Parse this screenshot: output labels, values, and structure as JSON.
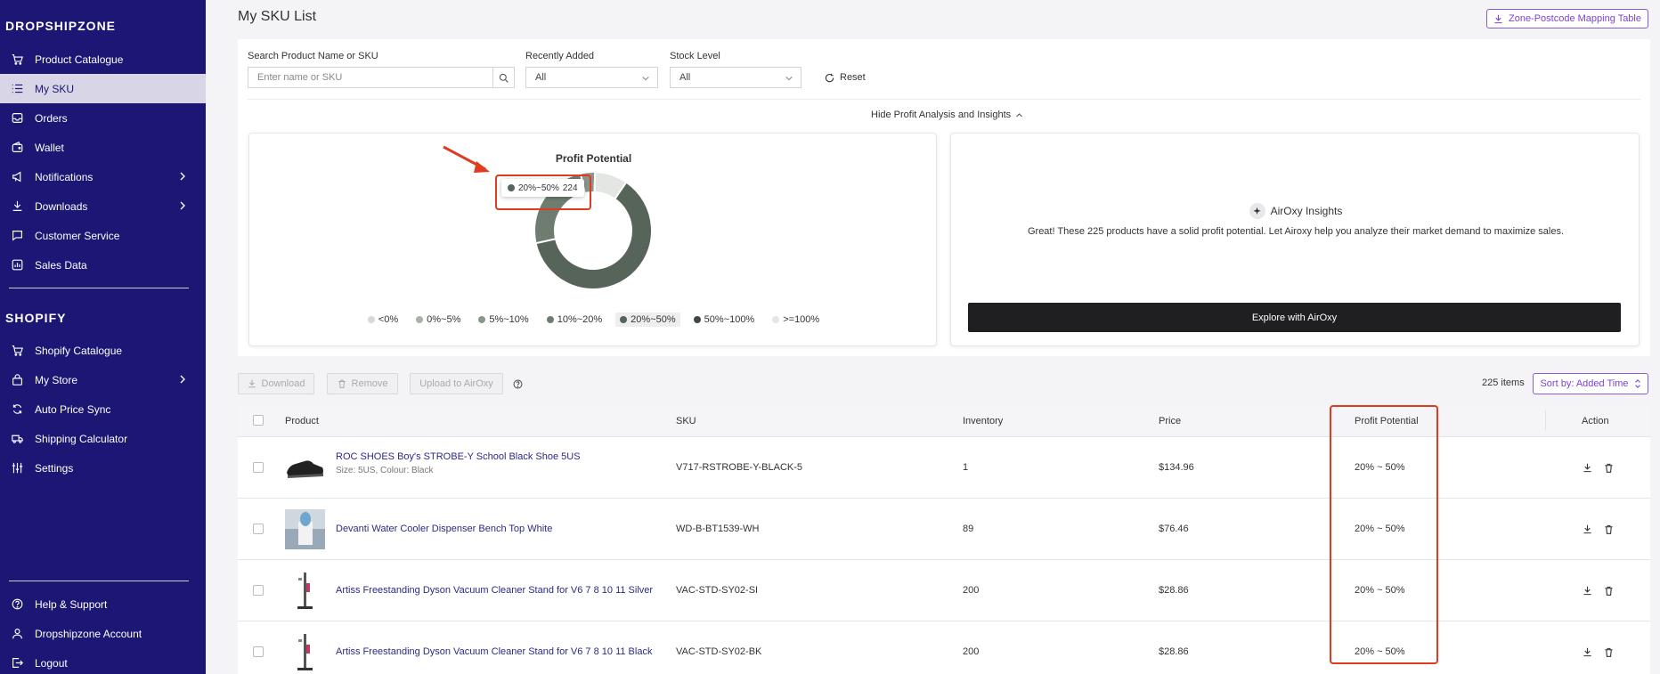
{
  "sidebar": {
    "brand": "DROPSHIPZONE",
    "items": [
      {
        "label": "Product Catalogue"
      },
      {
        "label": "My SKU"
      },
      {
        "label": "Orders"
      },
      {
        "label": "Wallet"
      },
      {
        "label": "Notifications"
      },
      {
        "label": "Downloads"
      },
      {
        "label": "Customer Service"
      },
      {
        "label": "Sales Data"
      }
    ],
    "shopify_heading": "SHOPIFY",
    "shopify_items": [
      {
        "label": "Shopify Catalogue"
      },
      {
        "label": "My Store"
      },
      {
        "label": "Auto Price Sync"
      },
      {
        "label": "Shipping Calculator"
      },
      {
        "label": "Settings"
      }
    ],
    "footer_items": [
      {
        "label": "Help & Support"
      },
      {
        "label": "Dropshipzone Account"
      },
      {
        "label": "Logout"
      }
    ]
  },
  "header": {
    "title": "My SKU List",
    "mapping_button": "Zone-Postcode Mapping Table"
  },
  "filters": {
    "search_label": "Search Product Name or SKU",
    "search_placeholder": "Enter name or SKU",
    "recent_label": "Recently Added",
    "recent_value": "All",
    "stock_label": "Stock Level",
    "stock_value": "All",
    "reset": "Reset",
    "toggle_insights": "Hide Profit Analysis and Insights"
  },
  "chart_data": {
    "type": "pie",
    "title": "Profit Potential",
    "categories": [
      "<0%",
      "0%~5%",
      "5%~10%",
      "10%~20%",
      "20%~50%",
      "50%~100%",
      ">=100%"
    ],
    "values": [
      0,
      0,
      0,
      0,
      224,
      0,
      0
    ],
    "tooltip": {
      "label": "20%~50%",
      "value": "224"
    },
    "colors": [
      "#d6d9d6",
      "#a9b2a9",
      "#8a968b",
      "#6e7d70",
      "#56645a",
      "#3e4a41",
      "#e3e6e3"
    ],
    "highlight": "20%~50%"
  },
  "insights": {
    "title": "AirOxy Insights",
    "text": "Great! These 225 products have a solid profit potential. Let Airoxy help you analyze their market demand to maximize sales.",
    "button": "Explore with AirOxy"
  },
  "toolbar": {
    "download": "Download",
    "remove": "Remove",
    "upload": "Upload to AirOxy",
    "count": "225 items",
    "sort": "Sort by: Added Time"
  },
  "table": {
    "headers": {
      "product": "Product",
      "sku": "SKU",
      "inventory": "Inventory",
      "price": "Price",
      "profit": "Profit Potential",
      "action": "Action"
    },
    "rows": [
      {
        "name": "ROC SHOES Boy's STROBE-Y School Black Shoe 5US",
        "sub": "Size: 5US, Colour: Black",
        "sku": "V717-RSTROBE-Y-BLACK-5",
        "inventory": "1",
        "price": "$134.96",
        "profit": "20% ~ 50%"
      },
      {
        "name": "Devanti Water Cooler Dispenser Bench Top White",
        "sub": "",
        "sku": "WD-B-BT1539-WH",
        "inventory": "89",
        "price": "$76.46",
        "profit": "20% ~ 50%"
      },
      {
        "name": "Artiss Freestanding Dyson Vacuum Cleaner Stand for V6 7 8 10 11 Silver",
        "sub": "",
        "sku": "VAC-STD-SY02-SI",
        "inventory": "200",
        "price": "$28.86",
        "profit": "20% ~ 50%"
      },
      {
        "name": "Artiss Freestanding Dyson Vacuum Cleaner Stand for V6 7 8 10 11 Black",
        "sub": "",
        "sku": "VAC-STD-SY02-BK",
        "inventory": "200",
        "price": "$28.86",
        "profit": "20% ~ 50%"
      }
    ]
  },
  "colors": {
    "sidebar": "#1c1674",
    "accent": "#7a44d0",
    "annotation": "#e03a1f"
  }
}
